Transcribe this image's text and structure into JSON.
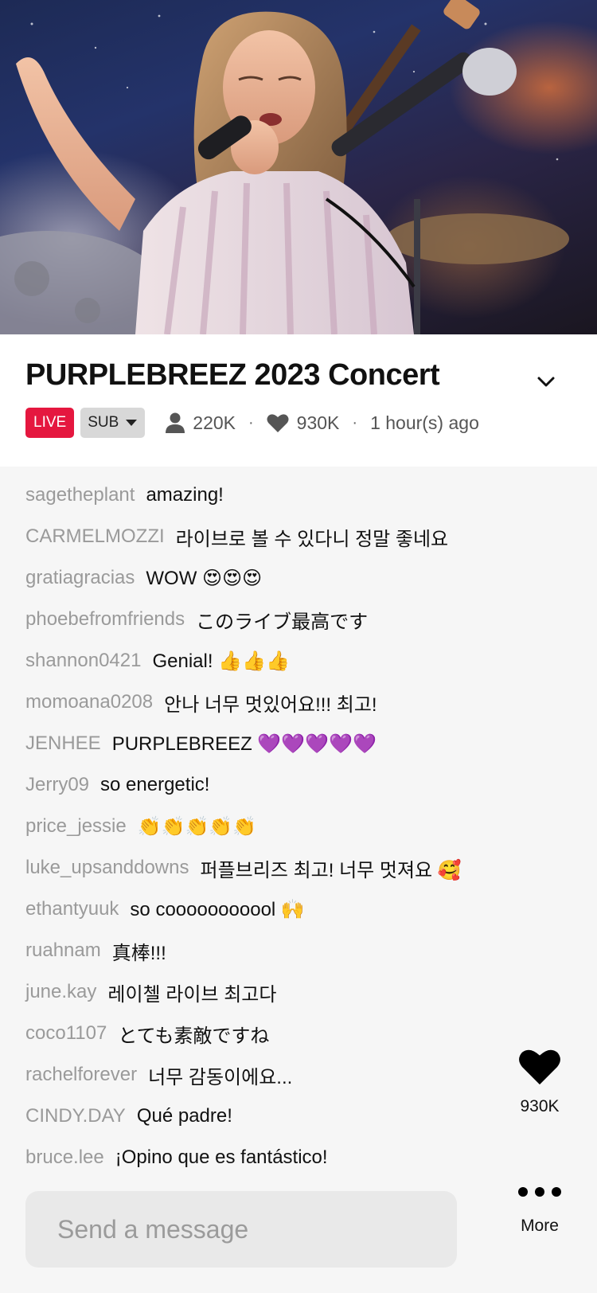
{
  "stream": {
    "title": "PURPLEBREEZ 2023 Concert",
    "live_label": "LIVE",
    "sub_label": "SUB",
    "viewers": "220K",
    "likes": "930K",
    "time_ago": "1 hour(s) ago",
    "separator": "·"
  },
  "chat": [
    {
      "user": "sagetheplant",
      "text": "amazing!"
    },
    {
      "user": "CARMELMOZZI",
      "text": "라이브로 볼 수 있다니 정말 좋네요"
    },
    {
      "user": "gratiagracias",
      "text": "WOW 😍😍😍"
    },
    {
      "user": "phoebefromfriends",
      "text": "このライブ最高です"
    },
    {
      "user": "shannon0421",
      "text": "Genial! 👍👍👍"
    },
    {
      "user": "momoana0208",
      "text": "안나 너무 멋있어요!!! 최고!"
    },
    {
      "user": "JENHEE",
      "text": "PURPLEBREEZ 💜💜💜💜💜"
    },
    {
      "user": "Jerry09",
      "text": "so energetic!"
    },
    {
      "user": "price_jessie",
      "text": "👏👏👏👏👏"
    },
    {
      "user": "luke_upsanddowns",
      "text": "퍼플브리즈 최고! 너무 멋져요 🥰"
    },
    {
      "user": "ethantyuuk",
      "text": "so cooooooooool 🙌"
    },
    {
      "user": "ruahnam",
      "text": "真棒!!!"
    },
    {
      "user": "june.kay",
      "text": "레이첼 라이브 최고다"
    },
    {
      "user": "coco1107",
      "text": "とても素敵ですね"
    },
    {
      "user": "rachelforever",
      "text": "너무 감동이에요..."
    },
    {
      "user": "CINDY.DAY",
      "text": "Qué padre!"
    },
    {
      "user": "bruce.lee",
      "text": "¡Opino que es fantástico!"
    }
  ],
  "actions": {
    "like_count": "930K",
    "more_label": "More"
  },
  "composer": {
    "placeholder": "Send a message",
    "value": ""
  },
  "icons": {
    "collapse": "chevron-down-icon",
    "sub_dropdown": "caret-down-icon",
    "viewers": "person-icon",
    "likes": "heart-icon",
    "like_action": "heart-icon",
    "more": "ellipsis-icon"
  },
  "colors": {
    "live_red": "#e5173f",
    "sub_gray": "#d8d8d8",
    "chat_user": "#9a9a9a",
    "background": "#f6f6f6"
  }
}
